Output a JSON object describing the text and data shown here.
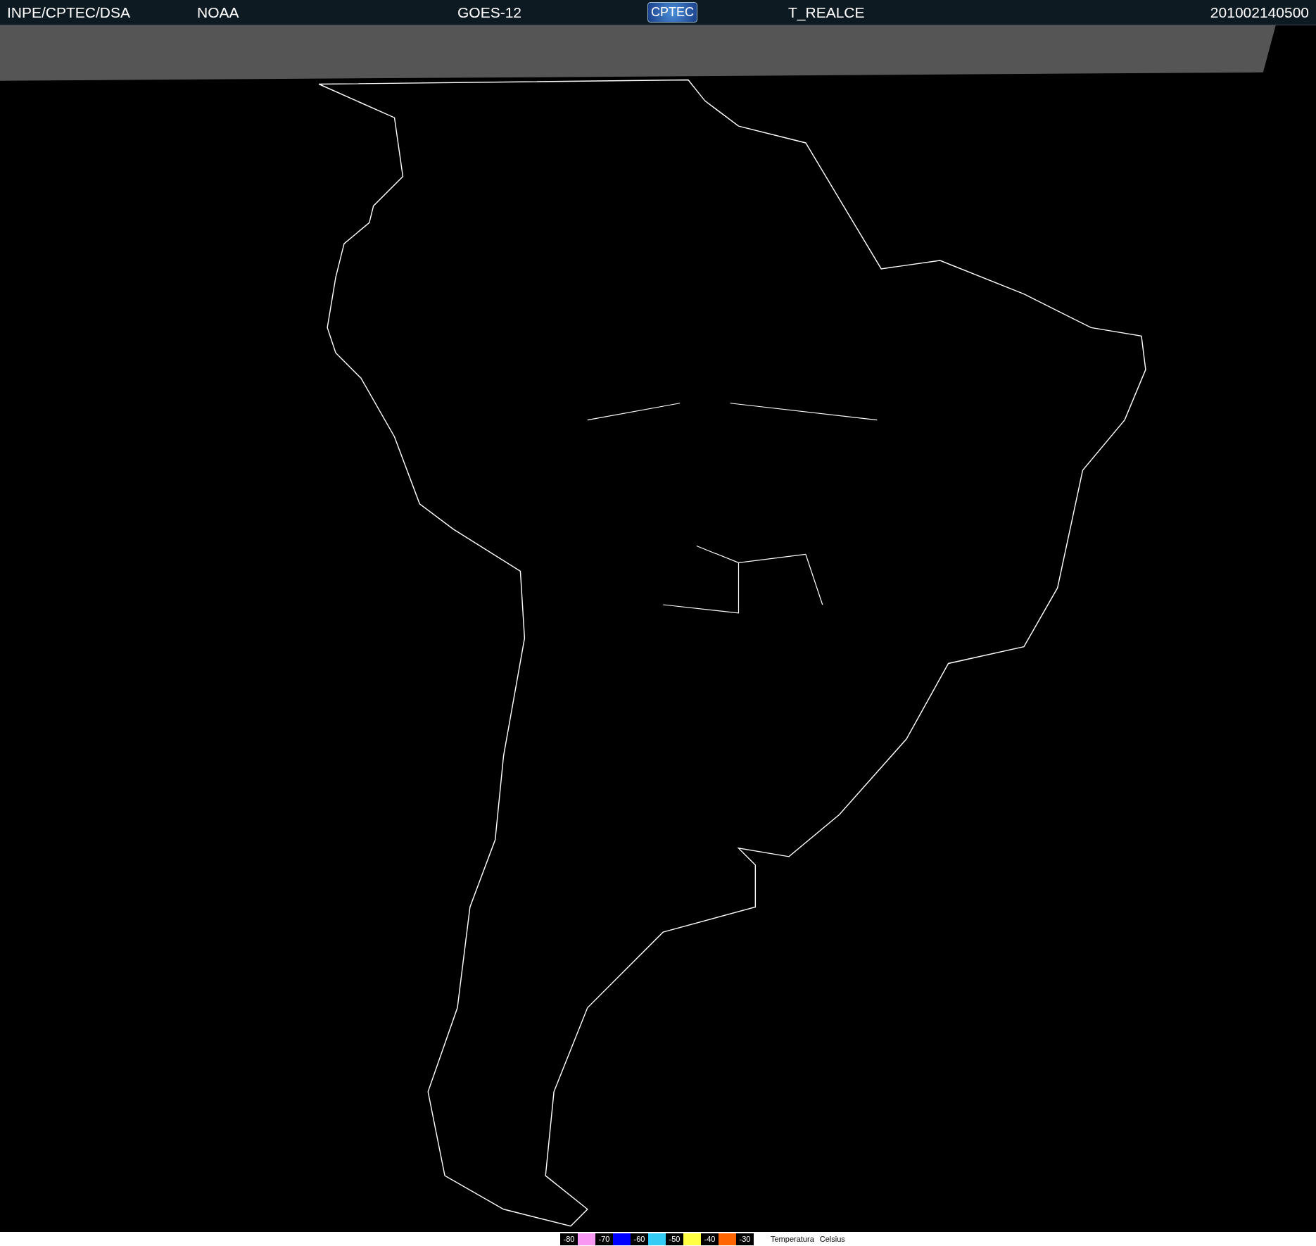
{
  "header": {
    "source": "INPE/CPTEC/DSA",
    "agency": "NOAA",
    "satellite": "GOES-12",
    "logo": "CPTEC",
    "product": "T_REALCE",
    "timestamp": "201002140500"
  },
  "legend": {
    "items": [
      {
        "kind": "tick",
        "label": "-80"
      },
      {
        "kind": "swatch",
        "color": "#f799f2"
      },
      {
        "kind": "tick",
        "label": "-70"
      },
      {
        "kind": "swatch",
        "color": "#0000ff"
      },
      {
        "kind": "tick",
        "label": "-60"
      },
      {
        "kind": "swatch",
        "color": "#33ccf5"
      },
      {
        "kind": "tick",
        "label": "-50"
      },
      {
        "kind": "swatch",
        "color": "#ffff44"
      },
      {
        "kind": "tick",
        "label": "-40"
      },
      {
        "kind": "swatch",
        "color": "#ff6600"
      },
      {
        "kind": "tick",
        "label": "-30"
      }
    ],
    "title": "Temperatura",
    "unit": "Celsius"
  }
}
